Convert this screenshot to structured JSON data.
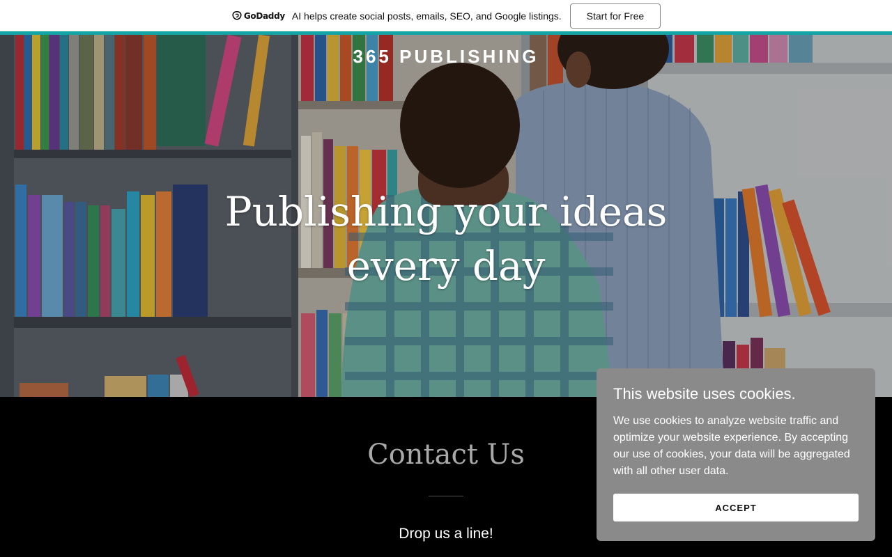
{
  "promo": {
    "logo_text": "GoDaddy",
    "message": "AI helps create social posts, emails, SEO, and Google listings.",
    "cta_label": "Start for Free",
    "accent_color": "#16a3a3"
  },
  "hero": {
    "site_title": "365 PUBLISHING",
    "heading": "Publishing your ideas every day"
  },
  "contact": {
    "title": "Contact Us",
    "subtitle": "Drop us a line!"
  },
  "cookie_banner": {
    "title": "This website uses cookies.",
    "body": "We use cookies to analyze website traffic and optimize your website experience. By accepting our use of cookies, your data will be aggregated with all other user data.",
    "accept_label": "ACCEPT"
  }
}
